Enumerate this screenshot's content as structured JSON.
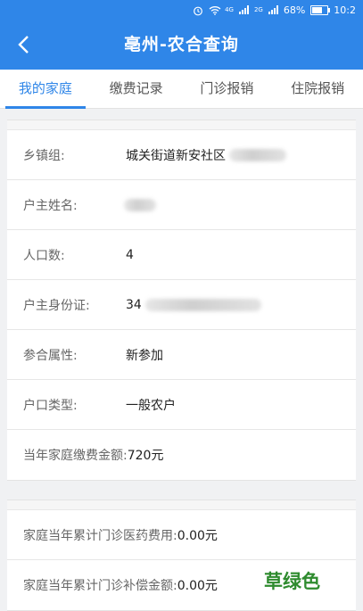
{
  "status_bar": {
    "network": "4G",
    "network2": "2G",
    "battery": "68%",
    "time": "10:2"
  },
  "header": {
    "title": "亳州-农合查询",
    "back_icon": "chevron-left-icon"
  },
  "tabs": [
    {
      "label": "我的家庭",
      "active": true
    },
    {
      "label": "缴费记录",
      "active": false
    },
    {
      "label": "门诊报销",
      "active": false
    },
    {
      "label": "住院报销",
      "active": false
    }
  ],
  "family": {
    "town_label": "乡镇组:",
    "town_value": "城关街道新安社区",
    "head_name_label": "户主姓名:",
    "head_name_value": "",
    "population_label": "人口数:",
    "population_value": "4",
    "id_label": "户主身份证:",
    "id_value": "34",
    "enroll_label": "参合属性:",
    "enroll_value": "新参加",
    "household_label": "户口类型:",
    "household_value": "一般农户",
    "fee_label": "当年家庭缴费金额:",
    "fee_value": "720元"
  },
  "outpatient": {
    "cost_label": "家庭当年累计门诊医药费用:",
    "cost_value": "0.00元",
    "comp_label": "家庭当年累计门诊补偿金额:",
    "comp_value": "0.00元"
  },
  "watermark": "草绿色",
  "colors": {
    "primary": "#2f86e8",
    "watermark": "#2e8b2e"
  }
}
